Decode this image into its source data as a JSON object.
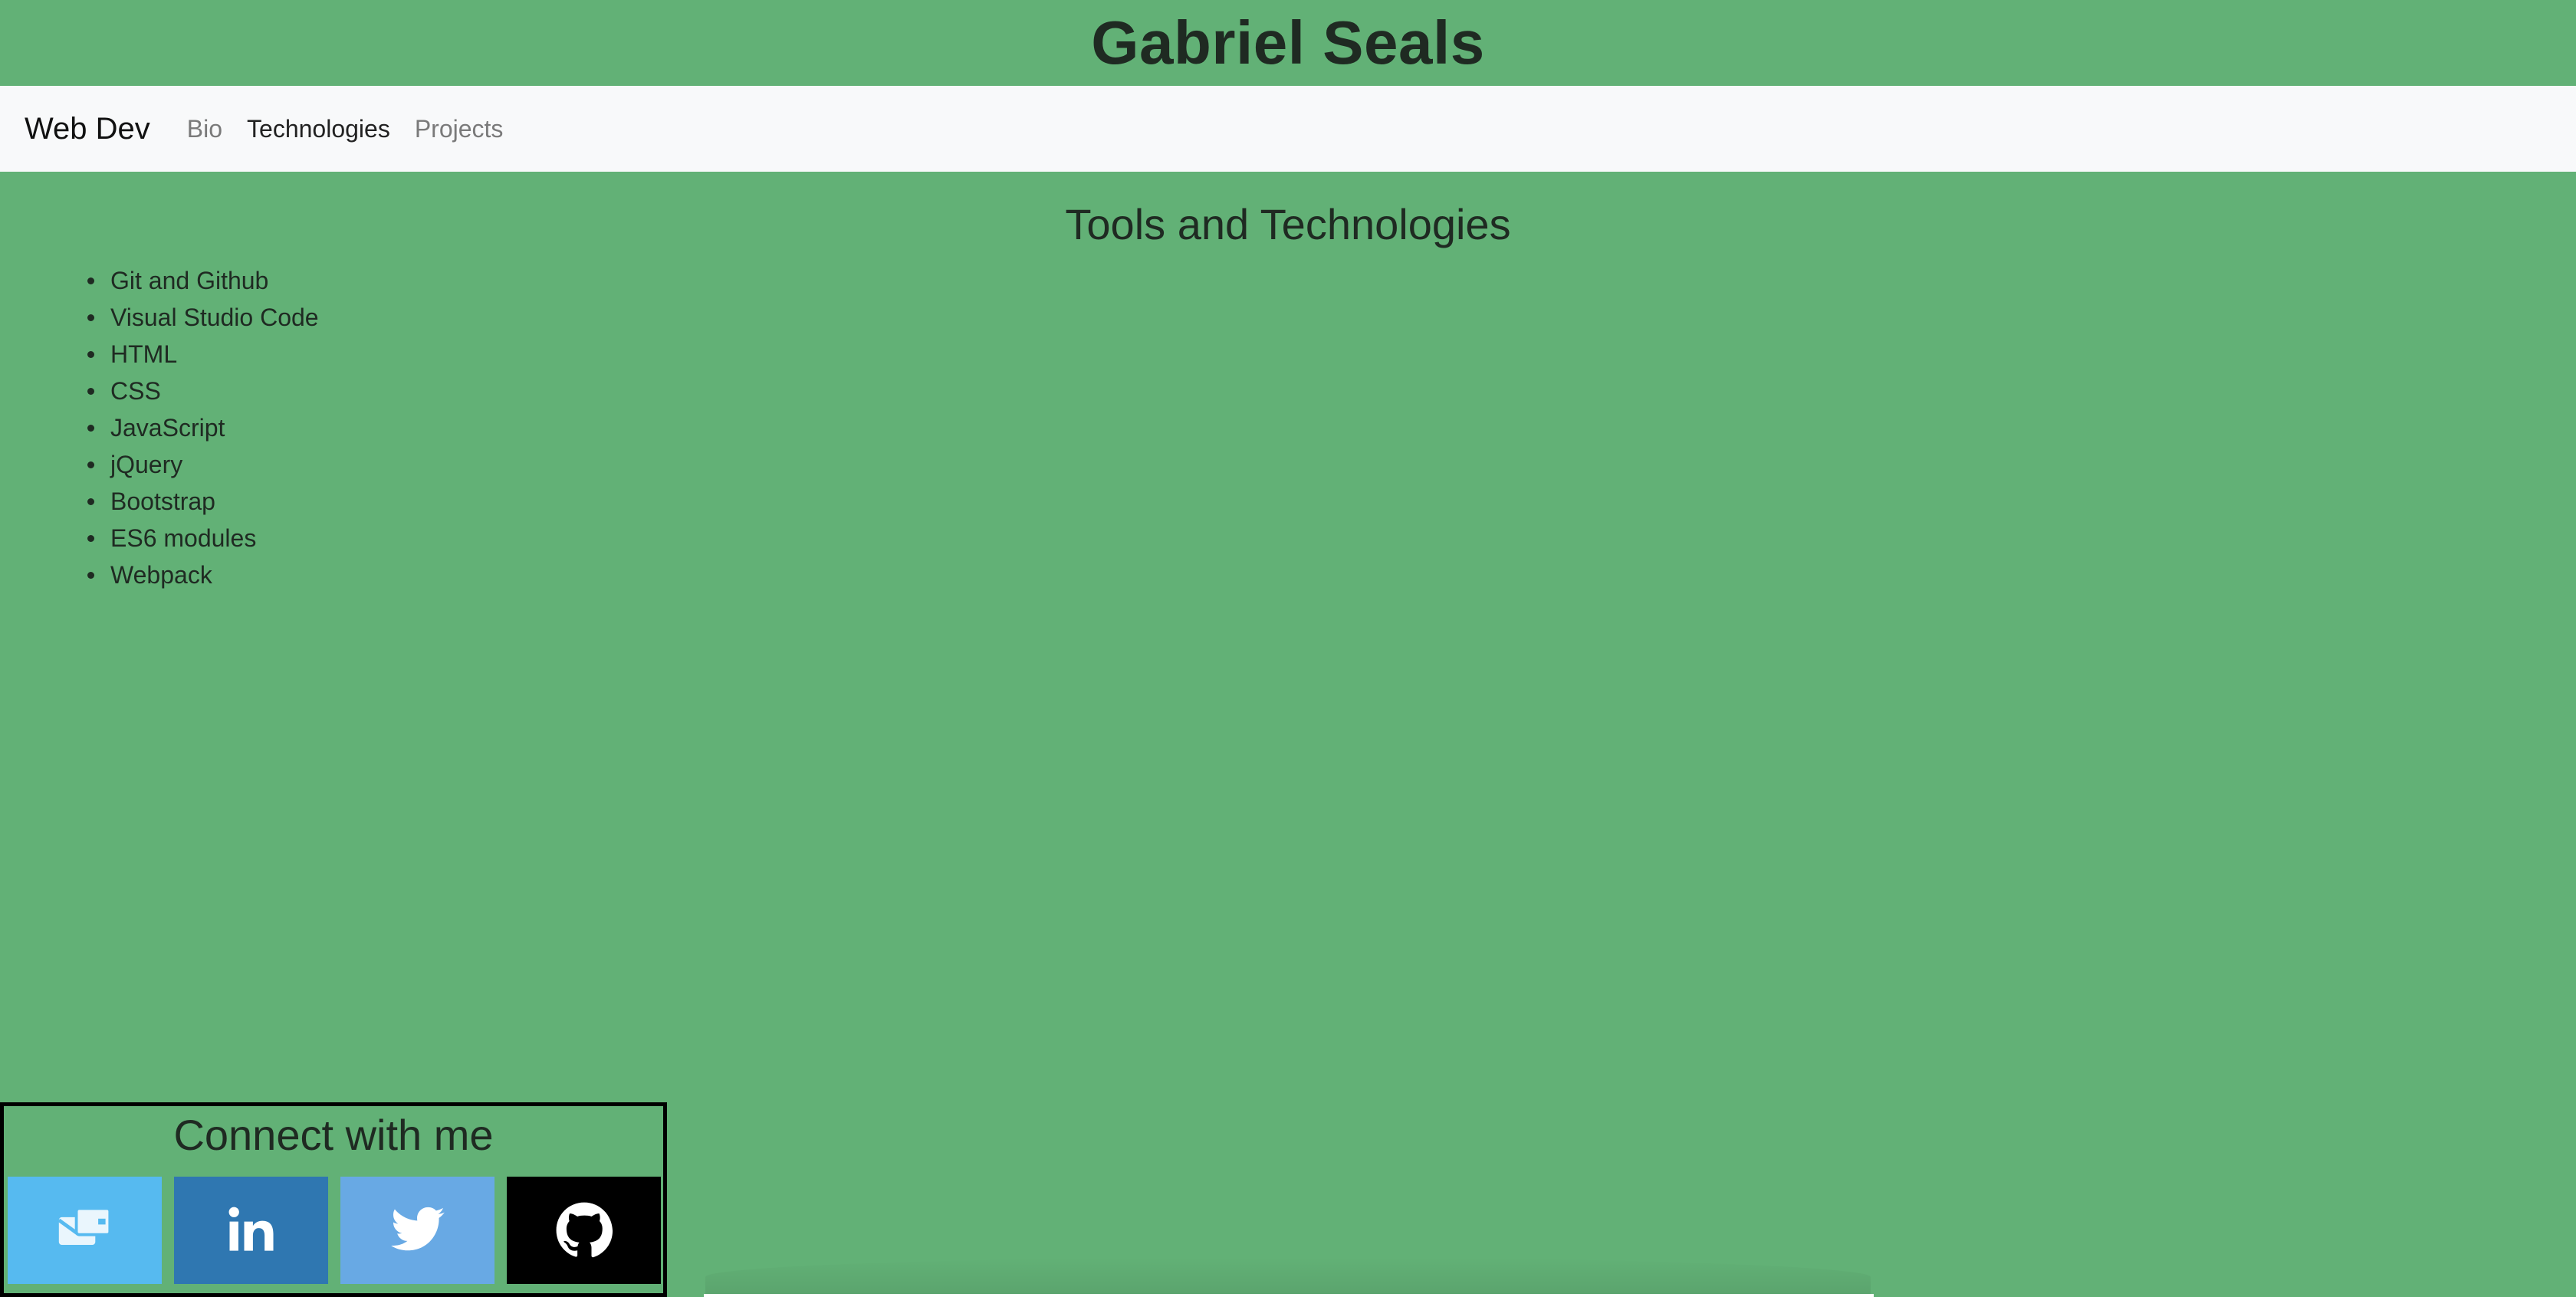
{
  "header": {
    "title": "Gabriel Seals"
  },
  "navbar": {
    "brand": "Web Dev",
    "links": [
      {
        "label": "Bio",
        "active": false
      },
      {
        "label": "Technologies",
        "active": true
      },
      {
        "label": "Projects",
        "active": false
      }
    ]
  },
  "main": {
    "title": "Tools and Technologies",
    "items": [
      "Git and Github",
      "Visual Studio Code",
      "HTML",
      "CSS",
      "JavaScript",
      "jQuery",
      "Bootstrap",
      "ES6 modules",
      "Webpack"
    ]
  },
  "connect": {
    "title": "Connect with me",
    "buttons": [
      {
        "icon": "email-icon",
        "color": "#56baf0"
      },
      {
        "icon": "linkedin-icon",
        "color": "#2f77b1"
      },
      {
        "icon": "twitter-icon",
        "color": "#68a9e4"
      },
      {
        "icon": "github-icon",
        "color": "#000000"
      }
    ]
  },
  "colors": {
    "page_background": "#62b176",
    "navbar_background": "#f8f9fa"
  }
}
